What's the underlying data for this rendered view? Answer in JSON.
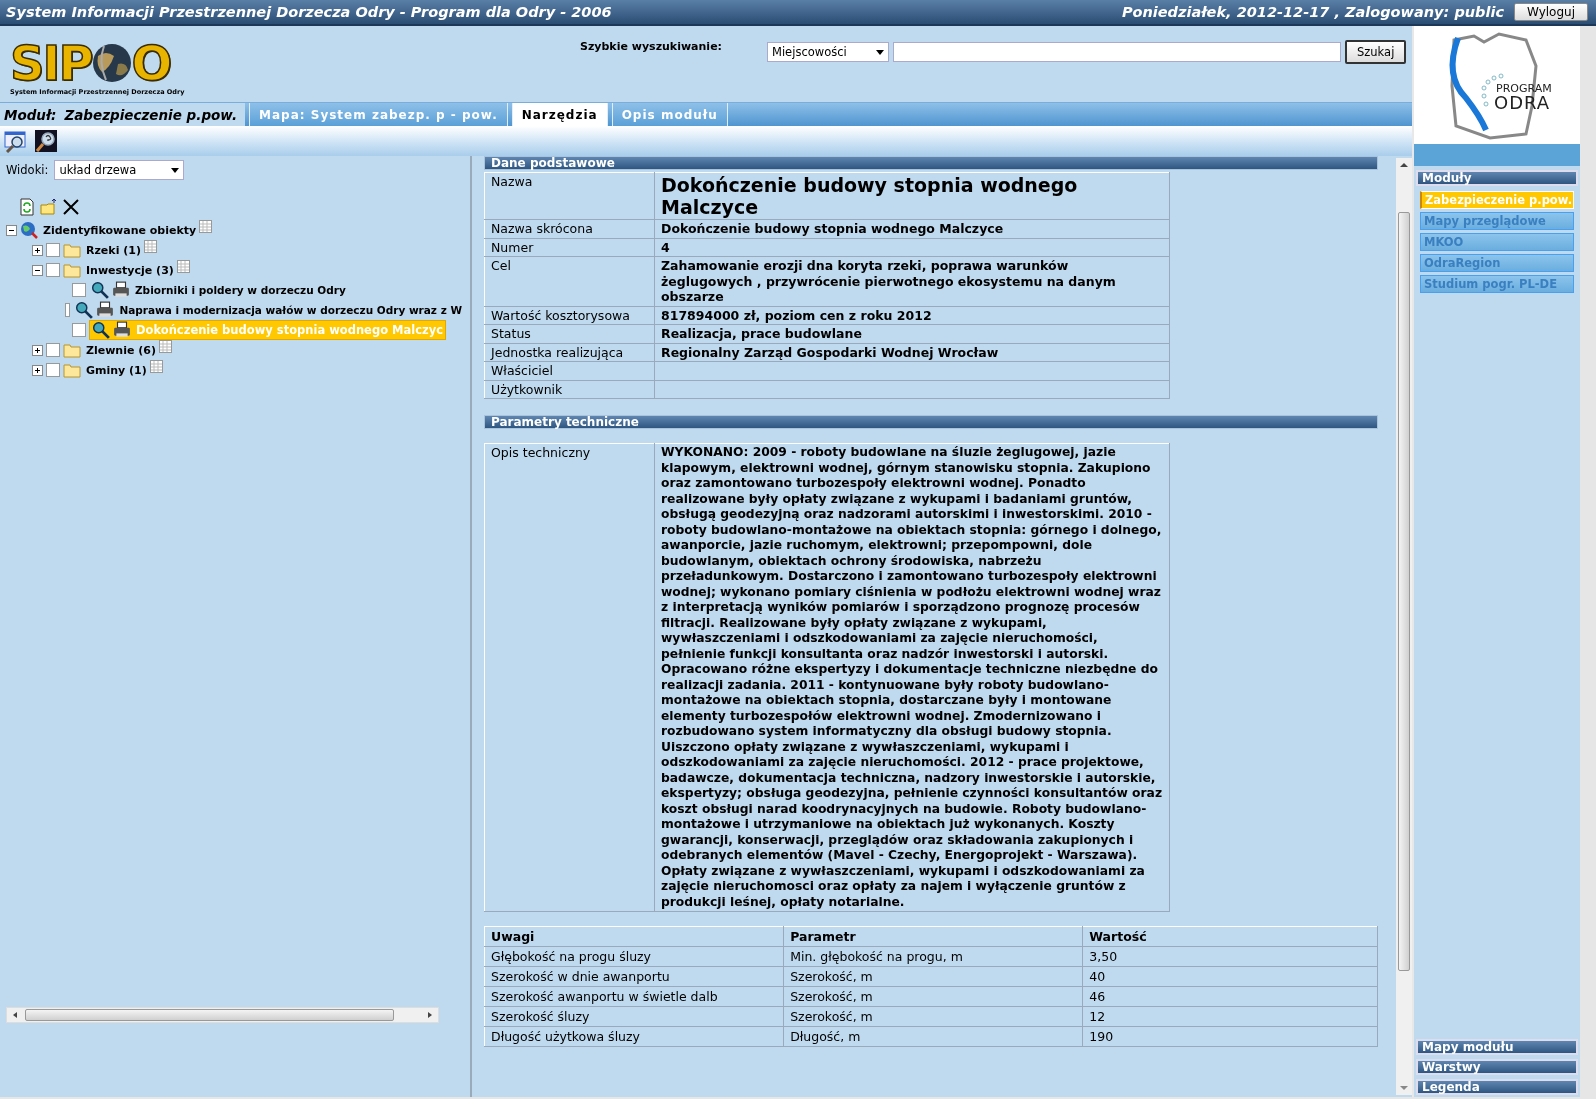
{
  "window": {
    "title": "System Informacji Przestrzennej Dorzecza Odry - Program dla Odry - 2006",
    "date_user": "Poniedziałek, 2012-12-17 , Zalogowany: public",
    "logout_button": "Wyloguj"
  },
  "logo": {
    "left": "SIP",
    "right": "O",
    "subtitle": "System Informacji Przestrzennej Dorzecza Odry"
  },
  "search": {
    "label": "Szybkie wyszukiwanie:",
    "category": "Miejscowości",
    "button": "Szukaj"
  },
  "module_bar": {
    "label": "Moduł:",
    "module": "Zabezpieczenie p.pow.",
    "tabs": [
      {
        "label": "Mapa: System zabezp. p - pow.",
        "selected": false
      },
      {
        "label": "Narzędzia",
        "selected": true
      },
      {
        "label": "Opis modułu",
        "selected": false
      }
    ]
  },
  "views": {
    "label": "Widoki:",
    "value": "układ drzewa"
  },
  "tree": [
    {
      "label": "Zidentyfikowane obiekty",
      "kind": "root",
      "expanded": true,
      "children": [
        {
          "label": "Rzeki (1)",
          "kind": "folder",
          "expanded": false,
          "checked": false
        },
        {
          "label": "Inwestycje (3)",
          "kind": "folder",
          "expanded": true,
          "checked": false,
          "children": [
            {
              "label": "Zbiorniki i poldery w dorzeczu Odry",
              "kind": "leaf",
              "checked": false,
              "selected": false
            },
            {
              "label": "Naprawa i modernizacja wałów w dorzeczu Odry wraz z W",
              "kind": "leaf",
              "checked": false,
              "selected": false
            },
            {
              "label": "Dokończenie budowy stopnia wodnego Malczyc",
              "kind": "leaf",
              "checked": false,
              "selected": true
            }
          ]
        },
        {
          "label": "Zlewnie (6)",
          "kind": "folder",
          "expanded": false,
          "checked": false
        },
        {
          "label": "Gminy (1)",
          "kind": "folder",
          "expanded": false,
          "checked": false
        }
      ]
    }
  ],
  "basic": {
    "title": "Dane podstawowe",
    "rows": [
      {
        "label": "Nazwa",
        "kind": "title",
        "value": "Dokończenie budowy stopnia wodnego Malczyce"
      },
      {
        "label": "Nazwa skrócona",
        "kind": "text",
        "value": "Dokończenie budowy stopnia wodnego Malczyce"
      },
      {
        "label": "Numer",
        "kind": "text",
        "value": "4"
      },
      {
        "label": "Cel",
        "kind": "text",
        "value": "Zahamowanie erozji dna koryta rzeki, poprawa warunków żeglugowych , przywrócenie pierwotnego ekosystemu na danym obszarze"
      },
      {
        "label": "Wartość kosztorysowa",
        "kind": "text",
        "value": "817894000 zł, poziom cen z roku 2012"
      },
      {
        "label": "Status",
        "kind": "text",
        "value": "Realizacja, prace budowlane"
      },
      {
        "label": "Jednostka realizująca",
        "kind": "text",
        "value": "Regionalny Zarząd Gospodarki Wodnej Wrocław"
      },
      {
        "label": "Właściciel",
        "kind": "text"
      },
      {
        "label": "Użytkownik",
        "kind": "text"
      }
    ]
  },
  "technical": {
    "title": "Parametry techniczne",
    "rows": [
      {
        "label": "Opis techniczny",
        "kind": "text",
        "value": "WYKONANO: 2009 - roboty budowlane na śluzie żeglugowej, jazie klapowym, elektrowni wodnej, górnym stanowisku stopnia. Zakupiono oraz zamontowano turbozespoły elektrowni wodnej. Ponadto realizowane były opłaty związane z wykupami i badaniami gruntów, obsługą geodezyjną oraz nadzorami autorskimi i inwestorskimi. 2010 - roboty budowlano-montażowe na obiektach stopnia: górnego i dolnego, awanporcie, jazie ruchomym, elektrowni; przepompowni, dole budowlanym, obiektach ochrony środowiska, nabrzeżu przeładunkowym. Dostarczono i zamontowano turbozespoły elektrowni wodnej; wykonano pomiary ciśnienia w podłożu elektrowni wodnej wraz z interpretacją wyników pomiarów i sporządzono prognozę procesów filtracji. Realizowane były opłaty związane z wykupami, wywłaszczeniami i odszkodowaniami za zajęcie nieruchomości, pełnienie funkcji konsultanta oraz nadzór inwestorski i autorski. Opracowano różne ekspertyzy i dokumentacje techniczne niezbędne do realizacji zadania. 2011 - kontynuowane były roboty budowlano-montażowe na obiektach stopnia, dostarczane były i montowane elementy turbozespołów elektrowni wodnej. Zmodernizowano i rozbudowano system informatyczny dla obsługi budowy stopnia. Uiszczono opłaty związane z wywłaszczeniami, wykupami i odszkodowaniami za zajęcie nieruchomości. 2012 - prace projektowe, badawcze, dokumentacja techniczna, nadzory inwestorskie i autorskie, ekspertyzy; obsługa geodezyjna, pełnienie czynności konsultantów oraz koszt obsługi narad koodrynacyjnych na budowie. Roboty budowlano-montażowe i utrzymaniowe na obiektach już wykonanych. Koszty gwarancji, konserwacji, przeglądów oraz składowania zakupionych i odebranych elementów (Mavel - Czechy, Energoprojekt - Warszawa). Opłaty związane z wywłaszczeniami, wykupami i odszkodowaniami za zajęcie nieruchomosci oraz opłaty za najem i wyłączenie gruntów z produkcji leśnej, opłaty notarialne."
      }
    ]
  },
  "parameters": {
    "columns": [
      "Uwagi",
      "Parametr",
      "Wartość"
    ],
    "rows": [
      [
        "Głębokość na progu śluzy",
        "Min. głębokość na progu, m",
        "3,50"
      ],
      [
        "Szerokość w dnie awanportu",
        "Szerokość, m",
        "40"
      ],
      [
        "Szerokość awanportu w świetle dalb",
        "Szerokość, m",
        "46"
      ],
      [
        "Szerokość śluzy",
        "Szerokość, m",
        "12"
      ],
      [
        "Długość użytkowa śluzy",
        "Długość, m",
        "190"
      ]
    ]
  },
  "sidebar": {
    "logo_top": "PROGRAM",
    "logo_bottom": "ODRA",
    "title": "Moduły",
    "items": [
      {
        "label": "Zabezpieczenie p.pow.",
        "selected": true
      },
      {
        "label": "Mapy przeglądowe",
        "selected": false
      },
      {
        "label": "MKOO",
        "selected": false
      },
      {
        "label": "OdraRegion",
        "selected": false
      },
      {
        "label": "Studium pogr. PL-DE",
        "selected": false
      }
    ],
    "panels": [
      "Mapy modułu",
      "Warstwy",
      "Legenda"
    ]
  }
}
